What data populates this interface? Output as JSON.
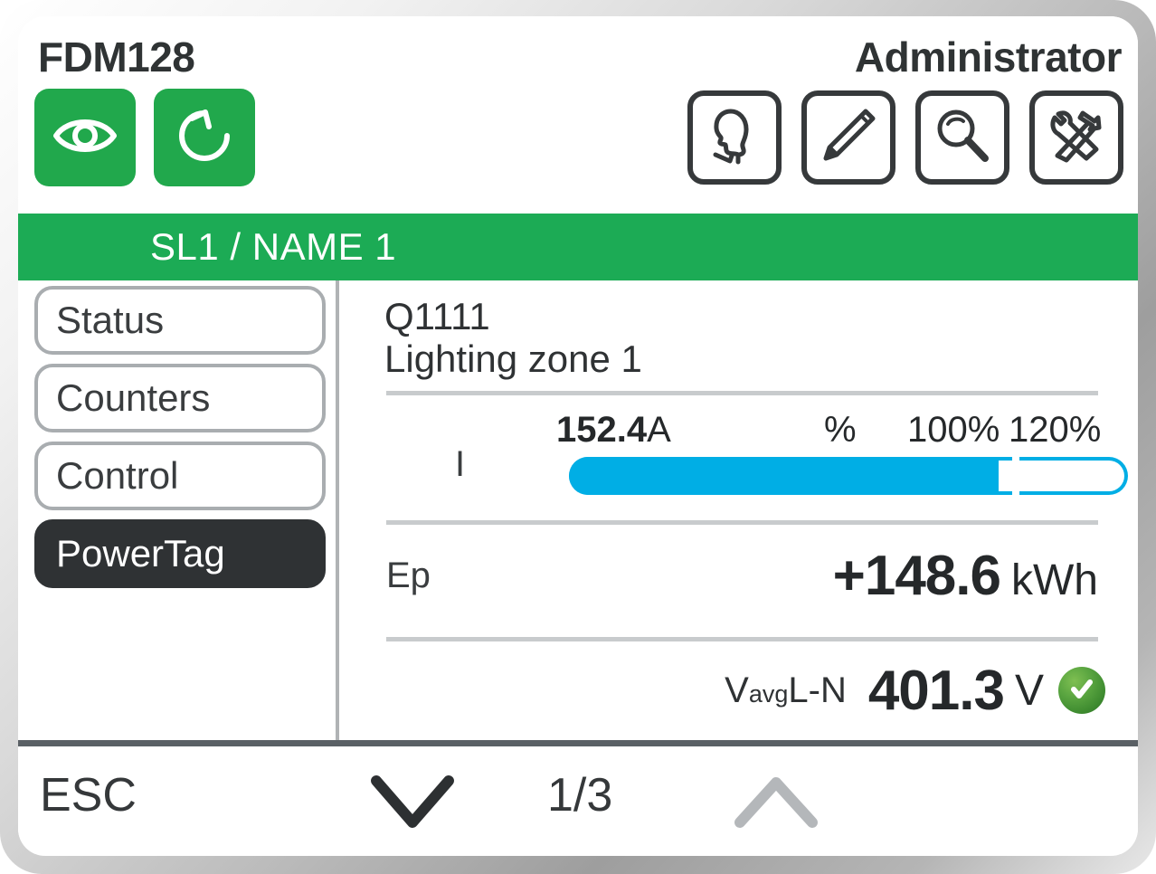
{
  "header": {
    "model": "FDM128",
    "user_role": "Administrator",
    "green_buttons": [
      {
        "name": "view-eye-icon",
        "label": "View"
      },
      {
        "name": "refresh-icon",
        "label": "Refresh"
      }
    ],
    "outline_buttons": [
      {
        "name": "user-profile-icon",
        "label": "User"
      },
      {
        "name": "edit-pencil-icon",
        "label": "Edit"
      },
      {
        "name": "search-magnifier-icon",
        "label": "Search"
      },
      {
        "name": "tools-icon",
        "label": "Maintenance"
      }
    ]
  },
  "breadcrumb": {
    "text": "SL1 / NAME 1"
  },
  "sidebar": {
    "items": [
      {
        "label": "Status",
        "active": false
      },
      {
        "label": "Counters",
        "active": false
      },
      {
        "label": "Control",
        "active": false
      },
      {
        "label": "PowerTag",
        "active": true
      }
    ]
  },
  "main": {
    "device_id": "Q1111",
    "device_name": "Lighting zone 1",
    "gauge": {
      "quantity_label": "I",
      "value": "152.4",
      "unit": "A",
      "percent_symbol": "%",
      "tick_100": "100%",
      "tick_120": "120%",
      "fill_percent": 97,
      "scale_max_percent": 120,
      "bar_color": "#00aee5"
    },
    "energy": {
      "label": "Ep",
      "value": "+148.6",
      "unit": "kWh"
    },
    "voltage": {
      "label_main": "V",
      "label_sub": "avg",
      "label_suffix": " L-N",
      "value": "401.3",
      "unit": "V",
      "status_icon": "check-ok-icon",
      "status_color": "#4d9338"
    }
  },
  "footer": {
    "esc_label": "ESC",
    "page_indicator": "1/3",
    "down_icon": "chevron-down-icon",
    "up_icon": "chevron-up-icon",
    "down_enabled": true,
    "up_enabled": false
  },
  "colors": {
    "brand_green": "#1cab55",
    "button_green": "#21a84c",
    "accent_blue": "#00aee5",
    "active_dark": "#2f3234",
    "text_dark": "#2f3334"
  }
}
